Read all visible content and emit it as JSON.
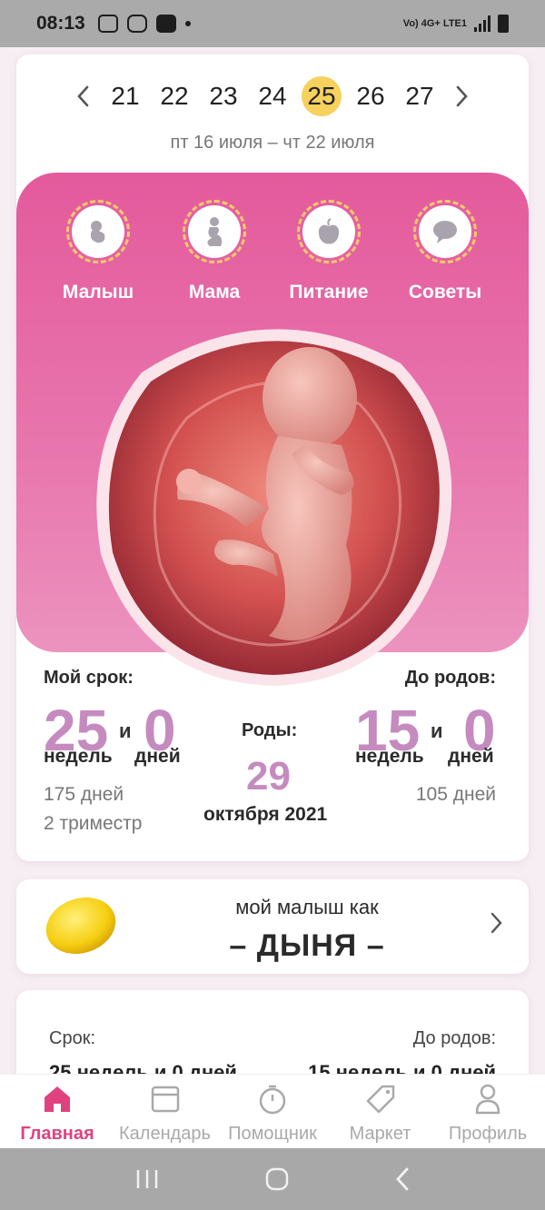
{
  "status_bar": {
    "time": "08:13",
    "network": "Vo) 4G+ LTE1"
  },
  "week_nav": {
    "weeks": [
      "21",
      "22",
      "23",
      "24",
      "25",
      "26",
      "27"
    ],
    "active_week": "25",
    "date_range": "пт 16 июля – чт 22 июля"
  },
  "categories": [
    {
      "label": "Малыш",
      "icon": "baby-icon"
    },
    {
      "label": "Мама",
      "icon": "pregnant-woman-icon"
    },
    {
      "label": "Питание",
      "icon": "apple-icon"
    },
    {
      "label": "Советы",
      "icon": "speech-bubble-icon"
    }
  ],
  "term": {
    "label": "Мой срок:",
    "weeks": "25",
    "conj": "и",
    "days": "0",
    "weeks_unit": "недель",
    "days_unit": "дней",
    "total_days": "175 дней",
    "trimester": "2 триместр"
  },
  "birth": {
    "label": "Роды:",
    "day": "29",
    "month_year": "октября 2021"
  },
  "remaining": {
    "label": "До родов:",
    "weeks": "15",
    "conj": "и",
    "days": "0",
    "weeks_unit": "недель",
    "days_unit": "дней",
    "total_days": "105 дней"
  },
  "comparison": {
    "caption": "мой малыш как",
    "fruit": "– ДЫНЯ –"
  },
  "summary_card": {
    "left_label": "Срок:",
    "right_label": "До родов:",
    "left_value": "25 недель и 0 дней",
    "right_value": "15 недель и 0 дней"
  },
  "bottom_nav": [
    {
      "label": "Главная",
      "icon": "home-icon"
    },
    {
      "label": "Календарь",
      "icon": "calendar-icon"
    },
    {
      "label": "Помощник",
      "icon": "timer-icon"
    },
    {
      "label": "Маркет",
      "icon": "tag-icon"
    },
    {
      "label": "Профиль",
      "icon": "profile-icon"
    }
  ],
  "colors": {
    "accent_pink": "#e0427f",
    "panel_pink": "#e45a9c",
    "number_mauve": "#c58bbf",
    "active_week": "#f6d15e"
  }
}
